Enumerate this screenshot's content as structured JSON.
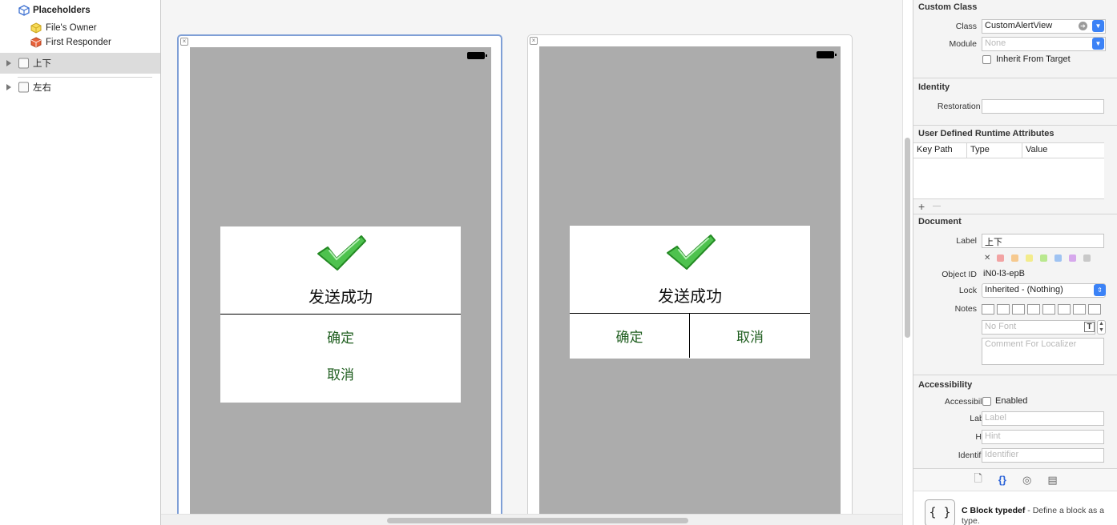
{
  "outline": {
    "placeholders": "Placeholders",
    "files_owner": "File's Owner",
    "first_responder": "First Responder",
    "view1": "上下",
    "view2": "左右"
  },
  "scenes": [
    {
      "title": "发送成功",
      "buttons": [
        "确定",
        "取消"
      ],
      "layout": "vertical"
    },
    {
      "title": "发送成功",
      "buttons": [
        "确定",
        "取消"
      ],
      "layout": "horizontal"
    }
  ],
  "inspector": {
    "custom_class": {
      "title": "Custom Class",
      "class_label": "Class",
      "class_value": "CustomAlertView",
      "module_label": "Module",
      "module_placeholder": "None",
      "inherit_label": "Inherit From Target"
    },
    "identity": {
      "title": "Identity",
      "restoration_label": "Restoration ID"
    },
    "runtime": {
      "title": "User Defined Runtime Attributes",
      "col_key": "Key Path",
      "col_type": "Type",
      "col_value": "Value",
      "add": "+",
      "remove": "—"
    },
    "document": {
      "title": "Document",
      "label_label": "Label",
      "label_value": "上下",
      "object_id_label": "Object ID",
      "object_id_value": "iN0-l3-epB",
      "lock_label": "Lock",
      "lock_value": "Inherited - (Nothing)",
      "notes_label": "Notes",
      "font_placeholder": "No Font",
      "comment_placeholder": "Comment For Localizer",
      "clear": "✕",
      "colors": [
        "#f2a3a3",
        "#f6c98f",
        "#f3ec8c",
        "#b9e88f",
        "#9fc3f2",
        "#d6a8ec",
        "#c9c9c9"
      ]
    },
    "accessibility": {
      "title": "Accessibility",
      "accessibility_label": "Accessibility",
      "enabled_label": "Enabled",
      "label_label": "Label",
      "label_placeholder": "Label",
      "hint_label": "Hint",
      "hint_placeholder": "Hint",
      "identifier_label": "Identifier",
      "identifier_placeholder": "Identifier"
    },
    "library": {
      "item_title": "C Block typedef",
      "item_desc": " - Define a block as a type.",
      "icon_text": "{ }"
    }
  },
  "colors": {
    "button_text": "#1f5e1f",
    "device_bg": "#acacac",
    "selection_border": "#7f9fd6",
    "accent": "#3b82f6"
  }
}
